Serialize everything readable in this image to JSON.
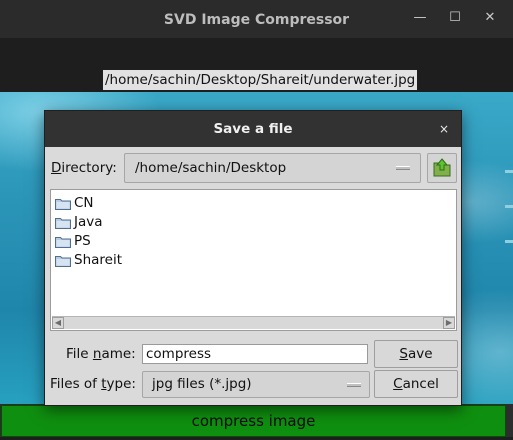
{
  "window": {
    "title": "SVD Image Compressor",
    "controls": {
      "minimize": "—",
      "maximize": "☐",
      "close": "✕"
    }
  },
  "path_label": "/home/sachin/Desktop/Shareit/underwater.jpg",
  "compress_button": "compress image",
  "dialog": {
    "title": "Save a file",
    "close": "×",
    "directory_label_first": "D",
    "directory_label_rest": "irectory:",
    "directory_value": "/home/sachin/Desktop",
    "folders": [
      "CN",
      "Java",
      "PS",
      "Shareit"
    ],
    "file_name_label_prefix": "File ",
    "file_name_label_ul": "n",
    "file_name_label_suffix": "ame:",
    "file_name_value": "compress",
    "files_of_type_label_prefix": "Files of ",
    "files_of_type_label_ul": "t",
    "files_of_type_label_suffix": "ype:",
    "files_of_type_value": "jpg files (*.jpg)",
    "save_label_ul": "S",
    "save_label_rest": "ave",
    "cancel_label_ul": "C",
    "cancel_label_rest": "ancel",
    "scroll_left": "◀",
    "scroll_right": "▶"
  },
  "colors": {
    "compress_button": "#0f8f0f",
    "dialog_title_bar": "#323232",
    "dialog_body": "#dadada",
    "water": "#2b95b8"
  }
}
